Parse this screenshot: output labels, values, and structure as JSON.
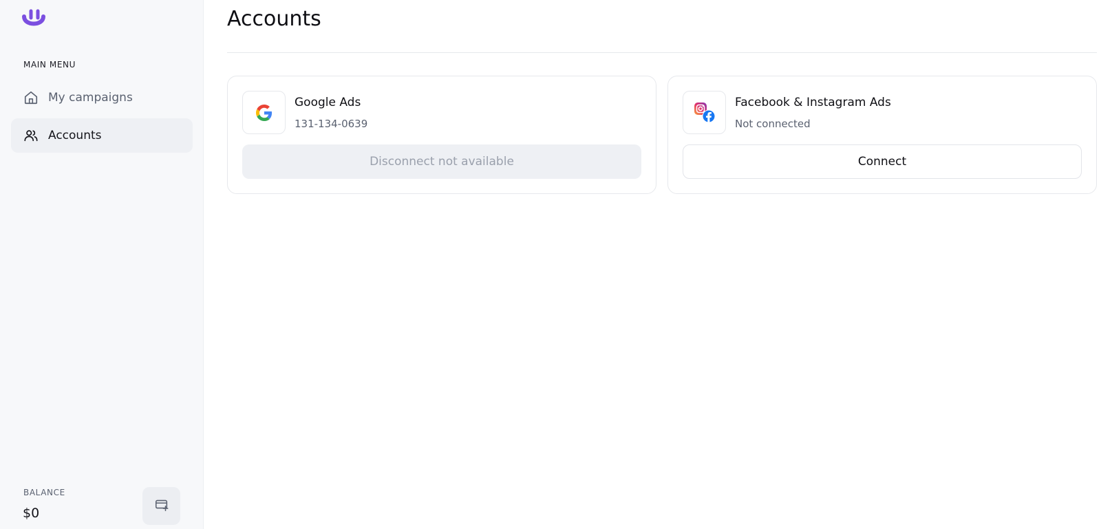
{
  "sidebar": {
    "menu_title": "MAIN MENU",
    "items": [
      {
        "label": "My campaigns",
        "icon": "home-icon",
        "active": false
      },
      {
        "label": "Accounts",
        "icon": "users-icon",
        "active": true
      }
    ],
    "balance": {
      "label": "BALANCE",
      "value": "$0",
      "action_icon": "add-card-icon"
    }
  },
  "main": {
    "title": "Accounts",
    "cards": [
      {
        "name": "Google Ads",
        "status": "131-134-0639",
        "button": "Disconnect not available",
        "icon": "google-icon"
      },
      {
        "name": "Facebook & Instagram Ads",
        "status": "Not connected",
        "button": "Connect",
        "icon": "facebook-instagram-icon"
      }
    ]
  },
  "colors": {
    "brand": "#7b4fe0",
    "sidebar_bg": "#f7f8fa",
    "active_bg": "#eef0f4",
    "facebook_blue": "#1877f2"
  }
}
